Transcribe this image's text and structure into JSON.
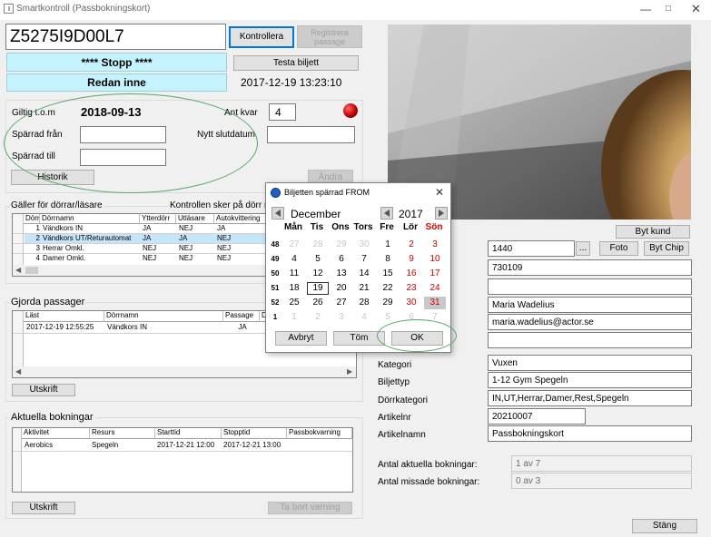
{
  "window": {
    "title": "Smartkontroll  (Passbokningskort)"
  },
  "ticket": {
    "number": "Z5275I9D00L7",
    "check_btn": "Kontrollera",
    "register_btn": "Registrera passage",
    "status1": "**** Stopp ****",
    "test_btn": "Testa biljett",
    "status2": "Redan inne",
    "timestamp": "2017-12-19 13:23:10"
  },
  "validity": {
    "valid_label": "Giltig t.o.m",
    "valid_value": "2018-09-13",
    "left_label": "Ant kvar",
    "left_value": "4",
    "blocked_from_label": "Spärrad från",
    "new_end_label": "Nytt slutdatum",
    "blocked_to_label": "Spärrad till",
    "history_btn": "Historik",
    "change_btn": "Ändra"
  },
  "doors": {
    "group_title": "Gäller för dörrar/läsare",
    "control_label": "Kontrollen sker på dörr nu",
    "headers": [
      "Dörrid",
      "Dörrnamn",
      "Ytterdörr",
      "Utläsare",
      "Autokvittering"
    ],
    "rows": [
      [
        "1",
        "Vändkors IN",
        "JA",
        "NEJ",
        "JA"
      ],
      [
        "2",
        "Vändkors UT/Returautomat",
        "JA",
        "JA",
        "NEJ"
      ],
      [
        "3",
        "Herrar Omkl.",
        "NEJ",
        "NEJ",
        "NEJ"
      ],
      [
        "4",
        "Damer Omkl.",
        "NEJ",
        "NEJ",
        "NEJ"
      ]
    ]
  },
  "passages": {
    "group_title": "Gjorda passager",
    "headers": [
      "Läst",
      "Dörrnamn",
      "Passage",
      "Di"
    ],
    "rows": [
      [
        "2017-12-19 12:55:25",
        "Vändkors IN",
        "JA",
        ""
      ]
    ],
    "print_btn": "Utskrift"
  },
  "bookings": {
    "group_title": "Aktuella bokningar",
    "headers": [
      "Aktivitet",
      "Resurs",
      "Starttid",
      "Stopptid",
      "Passbokvarning"
    ],
    "rows": [
      [
        "Aerobics",
        "Spegeln",
        "2017-12-21 12:00",
        "2017-12-21 13:00",
        ""
      ]
    ],
    "print_btn": "Utskrift",
    "remove_warning_btn": "Ta bort varning"
  },
  "customer": {
    "change_customer_btn": "Byt kund",
    "customer_no": "1440",
    "ellipsis_btn": "...",
    "photo_btn": "Foto",
    "change_chip_btn": "Byt Chip",
    "card_no": "730109",
    "name": "Maria Wadelius",
    "email": "maria.wadelius@actor.se"
  },
  "article": {
    "category_label": "Kategori",
    "category_value": "Vuxen",
    "ticket_type_label": "Biljettyp",
    "ticket_type_value": "1-12 Gym Spegeln",
    "door_cat_label": "Dörrkategori",
    "door_cat_value": "IN,UT,Herrar,Damer,Rest,Spegeln",
    "article_no_label": "Artikelnr",
    "article_no_value": "20210007",
    "article_name_label": "Artikelnamn",
    "article_name_value": "Passbokningskort",
    "active_bookings_label": "Antal aktuella bokningar:",
    "active_bookings_value": "1 av 7",
    "missed_bookings_label": "Antal missade bokningar:",
    "missed_bookings_value": "0 av 3",
    "close_btn": "Stäng"
  },
  "dialog": {
    "title": "Biljetten spärrad FROM",
    "month": "December",
    "year": "2017",
    "weekdays": [
      "Mån",
      "Tis",
      "Ons",
      "Tors",
      "Fre",
      "Lör",
      "Sön"
    ],
    "weeks": [
      "48",
      "49",
      "50",
      "51",
      "52",
      "1"
    ],
    "days": [
      [
        "27",
        "28",
        "29",
        "30",
        "1",
        "2",
        "3"
      ],
      [
        "4",
        "5",
        "6",
        "7",
        "8",
        "9",
        "10"
      ],
      [
        "11",
        "12",
        "13",
        "14",
        "15",
        "16",
        "17"
      ],
      [
        "18",
        "19",
        "20",
        "21",
        "22",
        "23",
        "24"
      ],
      [
        "25",
        "26",
        "27",
        "28",
        "29",
        "30",
        "31"
      ],
      [
        "1",
        "2",
        "3",
        "4",
        "5",
        "6",
        "7"
      ]
    ],
    "cancel_btn": "Avbryt",
    "clear_btn": "Töm",
    "ok_btn": "OK"
  },
  "colors": {
    "status_bg": "#c5f3fd",
    "selection": "#c6e4fa",
    "annotation": "#5aa66a",
    "weekend": "#cc0000"
  }
}
